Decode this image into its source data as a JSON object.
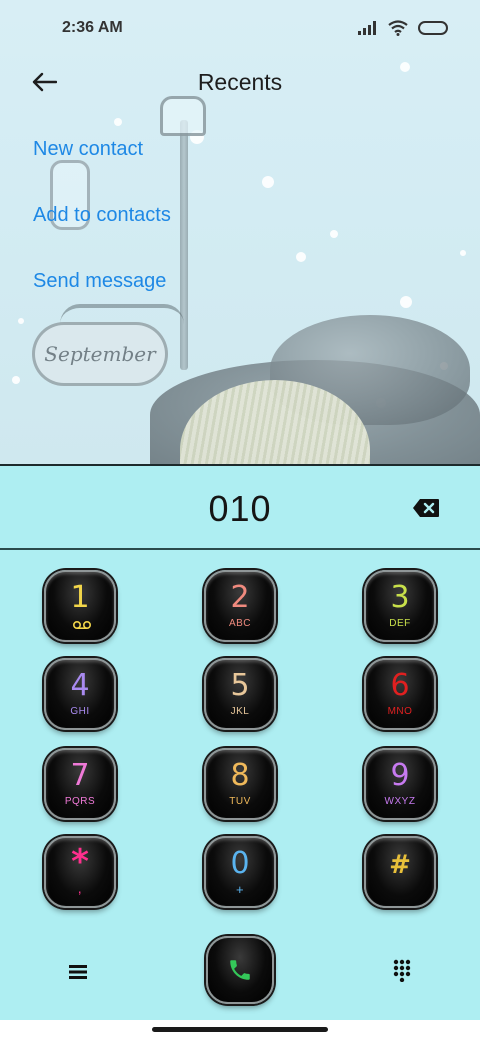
{
  "status_bar": {
    "time": "2:36 AM",
    "icons": [
      "signal-icon",
      "wifi-icon",
      "battery-icon"
    ]
  },
  "header": {
    "title": "Recents",
    "back_icon": "arrow-left-icon"
  },
  "wallpaper": {
    "sign_text": "September"
  },
  "menu": {
    "items": [
      {
        "label": "New contact"
      },
      {
        "label": "Add to contacts"
      },
      {
        "label": "Send message"
      }
    ],
    "color": "#1e88e5"
  },
  "dialer": {
    "number": "010",
    "backspace_icon": "backspace-icon",
    "background": "#aeeef2",
    "keys": [
      {
        "digit": "1",
        "letters": "",
        "color": "#f2d64a",
        "sub_icon": "voicemail-icon"
      },
      {
        "digit": "2",
        "letters": "ABC",
        "color": "#f08a7e"
      },
      {
        "digit": "3",
        "letters": "DEF",
        "color": "#c8e04a"
      },
      {
        "digit": "4",
        "letters": "GHI",
        "color": "#a98af0"
      },
      {
        "digit": "5",
        "letters": "JKL",
        "color": "#e8c79a"
      },
      {
        "digit": "6",
        "letters": "MNO",
        "color": "#e02020"
      },
      {
        "digit": "7",
        "letters": "PQRS",
        "color": "#f07ad8"
      },
      {
        "digit": "8",
        "letters": "TUV",
        "color": "#f0b95a"
      },
      {
        "digit": "9",
        "letters": "WXYZ",
        "color": "#c77af0"
      },
      {
        "digit": "*",
        "letters": ",",
        "color": "#ff2f8e"
      },
      {
        "digit": "0",
        "letters": "+",
        "color": "#5ab4f0"
      },
      {
        "digit": "#",
        "letters": "",
        "color": "#e8c03a"
      }
    ],
    "bottom": {
      "menu_icon": "hamburger-menu-icon",
      "call_icon": "phone-icon",
      "call_color": "#34c759",
      "dialpad_icon": "dialpad-icon"
    }
  }
}
